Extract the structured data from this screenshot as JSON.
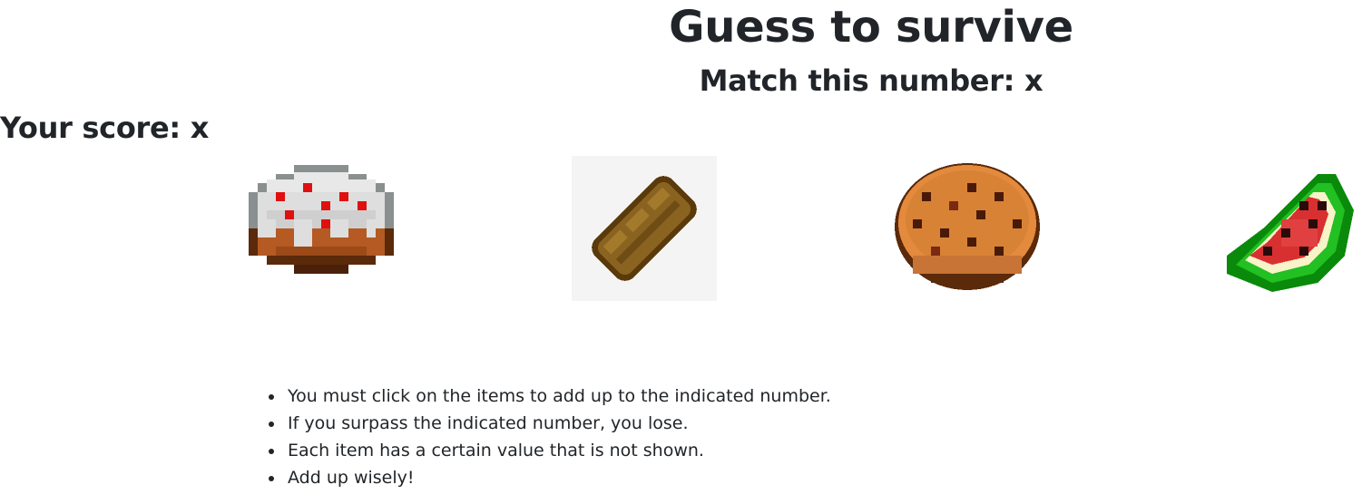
{
  "game": {
    "title": "Guess to survive",
    "target_label": "Match this number: x",
    "score_label": "Your score: x"
  },
  "items": [
    {
      "name": "cake",
      "icon": "cake-icon"
    },
    {
      "name": "bread",
      "icon": "bread-icon"
    },
    {
      "name": "cookie",
      "icon": "cookie-icon"
    },
    {
      "name": "melon-slice",
      "icon": "melon-slice-icon"
    }
  ],
  "rules": [
    "You must click on the items to add up to the indicated number.",
    "If you surpass the indicated number, you lose.",
    "Each item has a certain value that is not shown.",
    "Add up wisely!"
  ],
  "colors": {
    "text": "#212529",
    "background": "#ffffff"
  }
}
